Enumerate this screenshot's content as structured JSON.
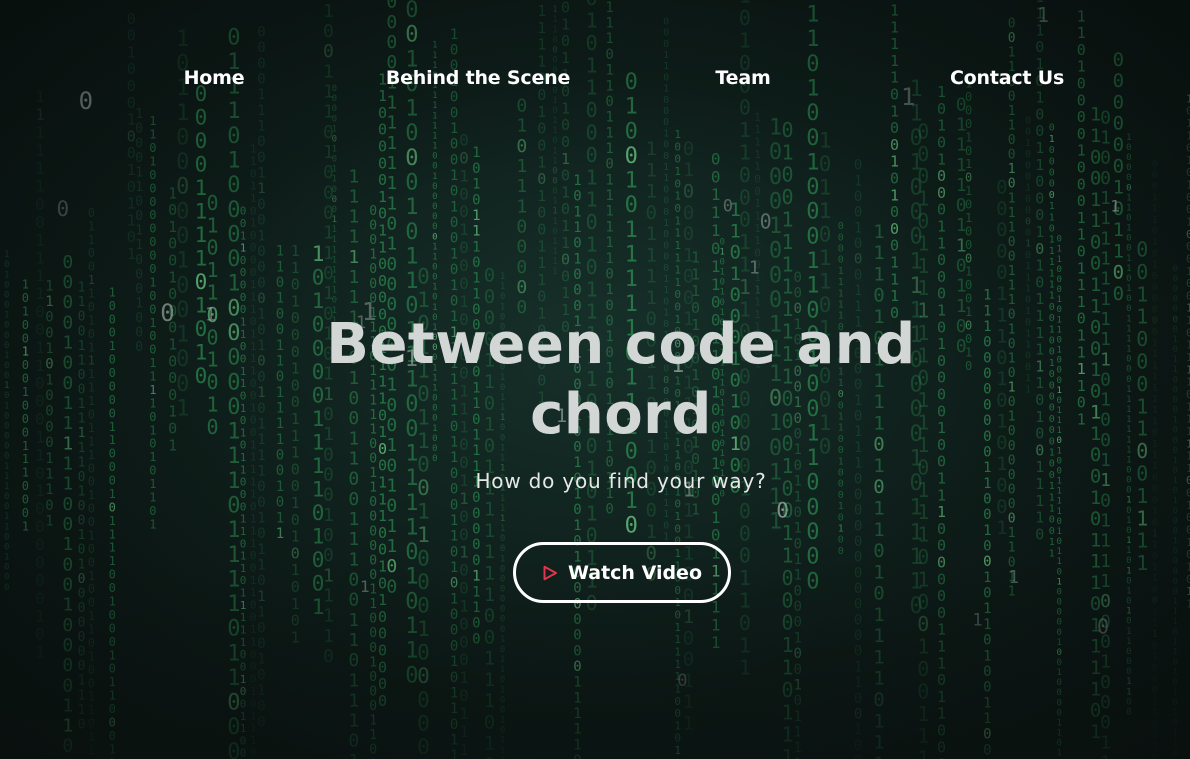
{
  "nav": {
    "items": [
      {
        "label": "Home"
      },
      {
        "label": "Behind the Scene"
      },
      {
        "label": "Team"
      },
      {
        "label": "Contact Us"
      }
    ]
  },
  "hero": {
    "title_line1": "Between code and",
    "title_line2": "chord",
    "subtitle": "How do you find your way?",
    "cta_label": "Watch Video"
  },
  "colors": {
    "background": "#0f1f1b",
    "code_rain": "#2fa05a",
    "code_rain_bright": "#7cf29a",
    "headline": "#d2d6d4",
    "text": "#ffffff",
    "play_icon": "#e0344f"
  },
  "icons": {
    "cta_icon": "play-icon",
    "background": "binary-code-rain"
  }
}
